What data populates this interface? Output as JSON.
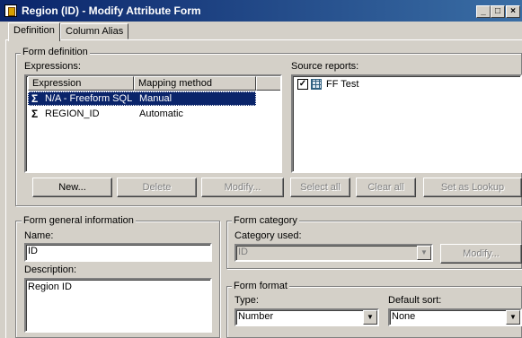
{
  "window": {
    "title": "Region (ID) - Modify Attribute Form"
  },
  "titlebar_buttons": {
    "minimize": "_",
    "maximize": "□",
    "close": "×"
  },
  "tabs": [
    {
      "label": "Definition",
      "active": true
    },
    {
      "label": "Column Alias",
      "active": false
    }
  ],
  "form_definition": {
    "group_title": "Form definition",
    "expressions_label": "Expressions:",
    "columns": [
      "Expression",
      "Mapping method"
    ],
    "rows": [
      {
        "expression": "N/A - Freeform SQL",
        "mapping": "Manual",
        "selected": true,
        "icon": "sigma-icon"
      },
      {
        "expression": "REGION_ID",
        "mapping": "Automatic",
        "selected": false,
        "icon": "sigma-icon"
      }
    ],
    "source_reports_label": "Source reports:",
    "source_reports": [
      {
        "name": "FF Test",
        "checked": true,
        "icon": "grid-report-icon"
      }
    ],
    "buttons": {
      "new": "New...",
      "delete": "Delete",
      "modify": "Modify...",
      "select_all": "Select all",
      "clear_all": "Clear all",
      "set_as_lookup": "Set as Lookup"
    }
  },
  "general_info": {
    "group_title": "Form general information",
    "name_label": "Name:",
    "name_value": "ID",
    "description_label": "Description:",
    "description_value": "Region ID"
  },
  "category": {
    "group_title": "Form category",
    "category_label": "Category used:",
    "category_value": "ID",
    "modify_label": "Modify..."
  },
  "format": {
    "group_title": "Form format",
    "type_label": "Type:",
    "type_value": "Number",
    "sort_label": "Default sort:",
    "sort_value": "None"
  }
}
